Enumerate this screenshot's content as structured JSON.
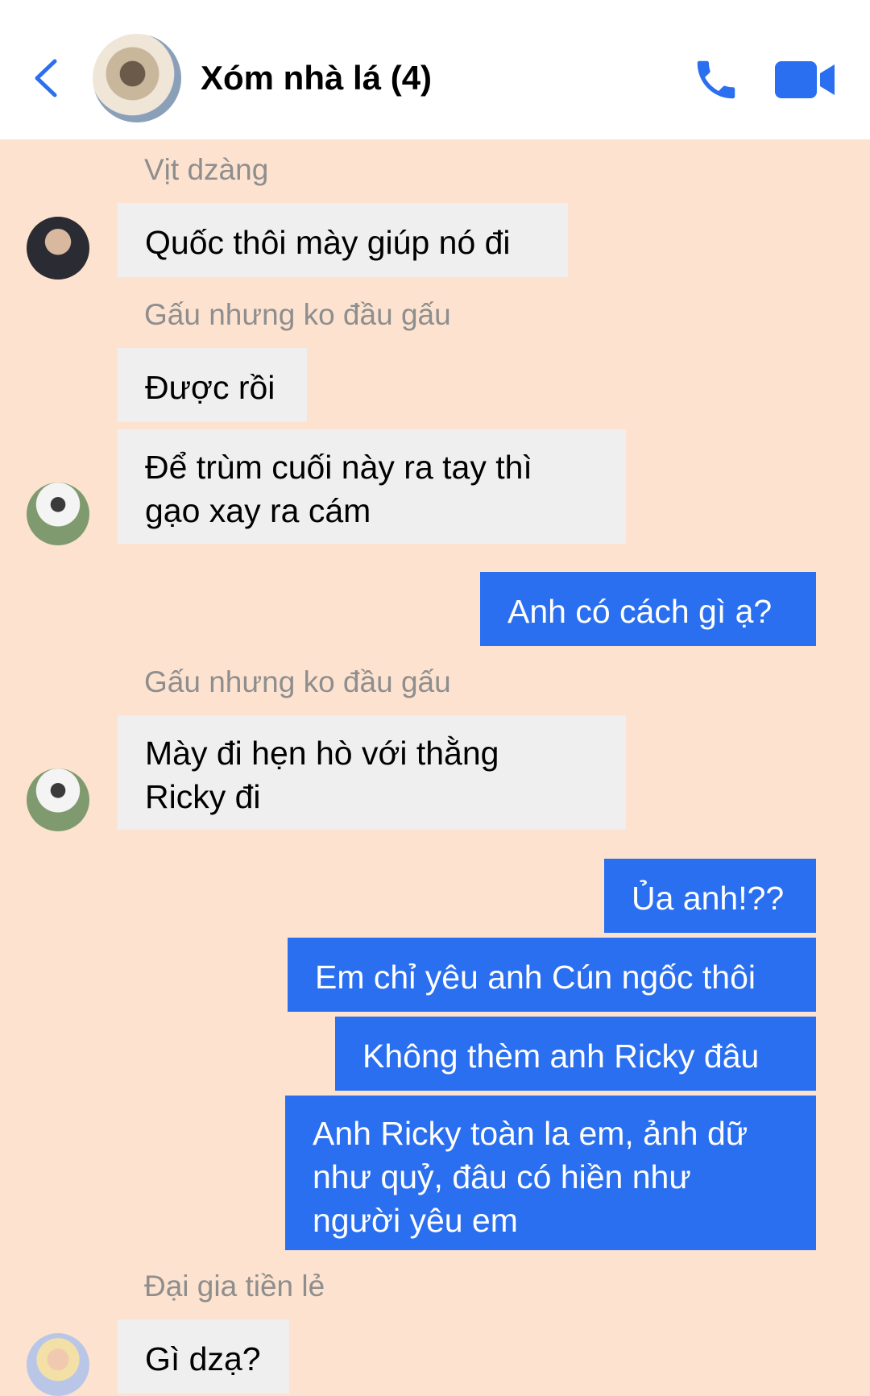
{
  "header": {
    "title": "Xóm nhà lá (4)",
    "back_icon": "chevron-left-icon",
    "call_icon": "phone-icon",
    "video_icon": "video-camera-icon",
    "accent_color": "#2a6ff0"
  },
  "messages": {
    "sender1": "Vịt dzàng",
    "m1": "Quốc thôi mày giúp nó đi",
    "sender2": "Gấu nhưng ko đầu gấu",
    "m2": "Được rồi",
    "m3_line1": "Để trùm cuối này ra tay thì",
    "m3_line2": "gạo xay ra cám",
    "m4": "Anh có cách gì ạ?",
    "sender3": "Gấu nhưng ko đầu gấu",
    "m5_line1": "Mày đi hẹn hò với thằng",
    "m5_line2": "Ricky đi",
    "m6": "Ủa anh!??",
    "m7": "Em chỉ yêu anh Cún ngốc thôi",
    "m8": "Không thèm anh Ricky đâu",
    "m9_line1": "Anh Ricky toàn la em, ảnh dữ",
    "m9_line2": "như quỷ, đâu có hiền như",
    "m9_line3": "người yêu em",
    "sender4": "Đại gia tiền lẻ",
    "m10": "Gì dzạ?"
  },
  "colors": {
    "background": "#fde3cf",
    "incoming_bubble": "#efefef",
    "outgoing_bubble": "#2a6ff0"
  }
}
